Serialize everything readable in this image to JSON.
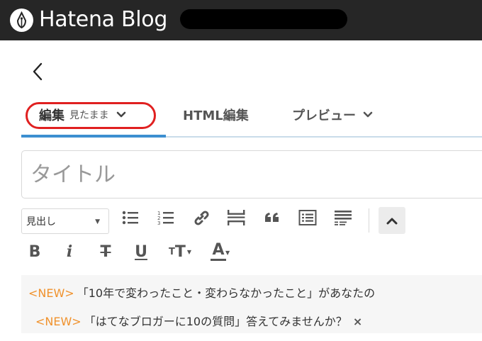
{
  "header": {
    "brand": "Hatena Blog"
  },
  "tabs": [
    {
      "label": "編集",
      "sub": "見たまま"
    },
    {
      "label": "HTML編集"
    },
    {
      "label": "プレビュー"
    }
  ],
  "title_input": {
    "placeholder": "タイトル",
    "value": ""
  },
  "toolbar": {
    "heading_select": "見出し",
    "bold": "B",
    "italic": "i",
    "strike": "T",
    "underline": "U",
    "font_size_small": "T",
    "font_size_big": "T",
    "font_color": "A"
  },
  "notices": [
    {
      "badge": "<NEW>",
      "text": "「10年で変わったこと・変わらなかったこと」があなたの"
    },
    {
      "badge": "<NEW>",
      "text": "「はてなブロガーに10の質問」答えてみませんか？",
      "close": "×"
    }
  ],
  "colors": {
    "topbar": "#262626",
    "active_tab": "#3c8fd0",
    "highlight": "#e02020",
    "new_badge": "#f0922d"
  }
}
